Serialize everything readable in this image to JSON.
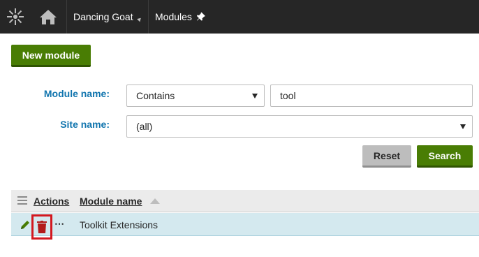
{
  "topbar": {
    "logo_icon": "kentico-logo-icon",
    "home_icon": "home-icon",
    "site_name": "Dancing Goat",
    "app_name": "Modules",
    "pin_icon": "pin-icon"
  },
  "actions": {
    "new_module_label": "New module"
  },
  "filter": {
    "module_name_label": "Module name:",
    "module_name_operator": "Contains",
    "module_name_value": "tool",
    "site_name_label": "Site name:",
    "site_name_value": "(all)",
    "reset_label": "Reset",
    "search_label": "Search"
  },
  "grid": {
    "columns": [
      "Actions",
      "Module name"
    ],
    "sort": "ascending",
    "rows": [
      {
        "name": "Toolkit Extensions",
        "actions": [
          "edit-icon",
          "delete-icon",
          "more-icon"
        ]
      }
    ]
  },
  "colors": {
    "topbar": "#262626",
    "primary_button": "#497d04",
    "label": "#1175ae",
    "row_highlight": "#d4e9ef",
    "delete_icon": "#b31b1b",
    "highlight_box": "#d3181f"
  }
}
